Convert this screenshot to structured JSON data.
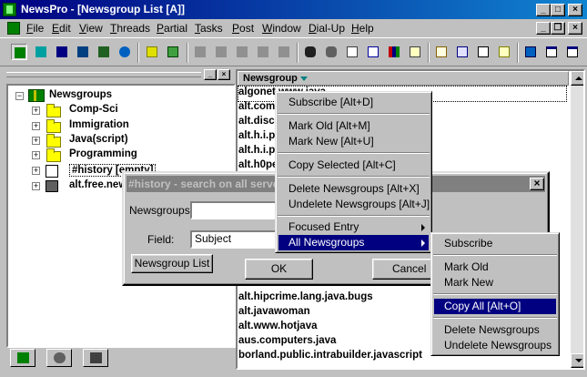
{
  "window": {
    "title": "NewsPro - [Newsgroup List [A]]",
    "controls": {
      "minimize": "_",
      "maximize": "□",
      "close": "×"
    },
    "mdi_controls": {
      "minimize": "_",
      "restore": "❐",
      "close": "×"
    }
  },
  "menubar": [
    "File",
    "Edit",
    "View",
    "Threads",
    "Partial",
    "Tasks",
    "Post",
    "Window",
    "Dial-Up",
    "Help"
  ],
  "toolbar_icons": [
    "tree-view-icon",
    "move-icon",
    "newsgroups-icon",
    "book-icon",
    "server-icon",
    "search-globe-icon",
    "new-folder-icon",
    "delete-folder-icon",
    "post-new-icon",
    "reply-icon",
    "forward-icon",
    "cancel-post-icon",
    "stop-icon",
    "find-icon",
    "find-next-icon",
    "filter-icon",
    "search-icon",
    "stats-icon",
    "help-icon",
    "mail-icon",
    "outbox-icon",
    "print-icon",
    "save-icon",
    "options-icon",
    "window-icon"
  ],
  "tree": {
    "root": "Newsgroups",
    "folders": [
      "Comp-Sci",
      "Immigration",
      "Java(script)",
      "Programming"
    ],
    "history": "#history [empty]",
    "server": "alt.free.new"
  },
  "left_tabs": [
    "newsgroups-tab",
    "tools-tab",
    "server-tab"
  ],
  "list": {
    "header": "Newsgroup",
    "rows_top": [
      "algonet.www.java",
      "alt.com",
      "alt.disc",
      "alt.h.i.p",
      "alt.h.i.p",
      "alt.h0pe"
    ],
    "rows_bottom": [
      "alt.hipcrime.lang.java.bugs",
      "alt.javawoman",
      "alt.www.hotjava",
      "aus.computers.java",
      "borland.public.intrabuilder.javascript"
    ]
  },
  "dialog": {
    "title": "#history - search on all serve",
    "newsgroups_label": "Newsgroups:",
    "newsgroups_value": "",
    "field_label": "Field:",
    "field_value": "Subject",
    "newsgroup_list_button": "Newsgroup List",
    "ok_button": "OK",
    "cancel_button": "Cancel",
    "close": "×"
  },
  "context_menu": {
    "items": [
      {
        "label": "Subscribe  [Alt+D]"
      },
      {
        "label": "Mark Old   [Alt+M]"
      },
      {
        "label": "Mark New  [Alt+U]"
      },
      {
        "label": "Copy Selected [Alt+C]"
      },
      {
        "label": "Delete Newsgroups   [Alt+X]"
      },
      {
        "label": "Undelete Newsgroups [Alt+J]"
      },
      {
        "label": "Focused Entry"
      },
      {
        "label": "All Newsgroups"
      }
    ]
  },
  "submenu": {
    "items": [
      {
        "label": "Subscribe"
      },
      {
        "label": "Mark Old"
      },
      {
        "label": "Mark New"
      },
      {
        "label": "Copy All [Alt+O]"
      },
      {
        "label": "Delete Newsgroups"
      },
      {
        "label": "Undelete Newsgroups"
      }
    ]
  },
  "colors": {
    "title_active": "#000080",
    "title_inactive": "#808080",
    "face": "#c0c0c0",
    "highlight": "#000080"
  }
}
